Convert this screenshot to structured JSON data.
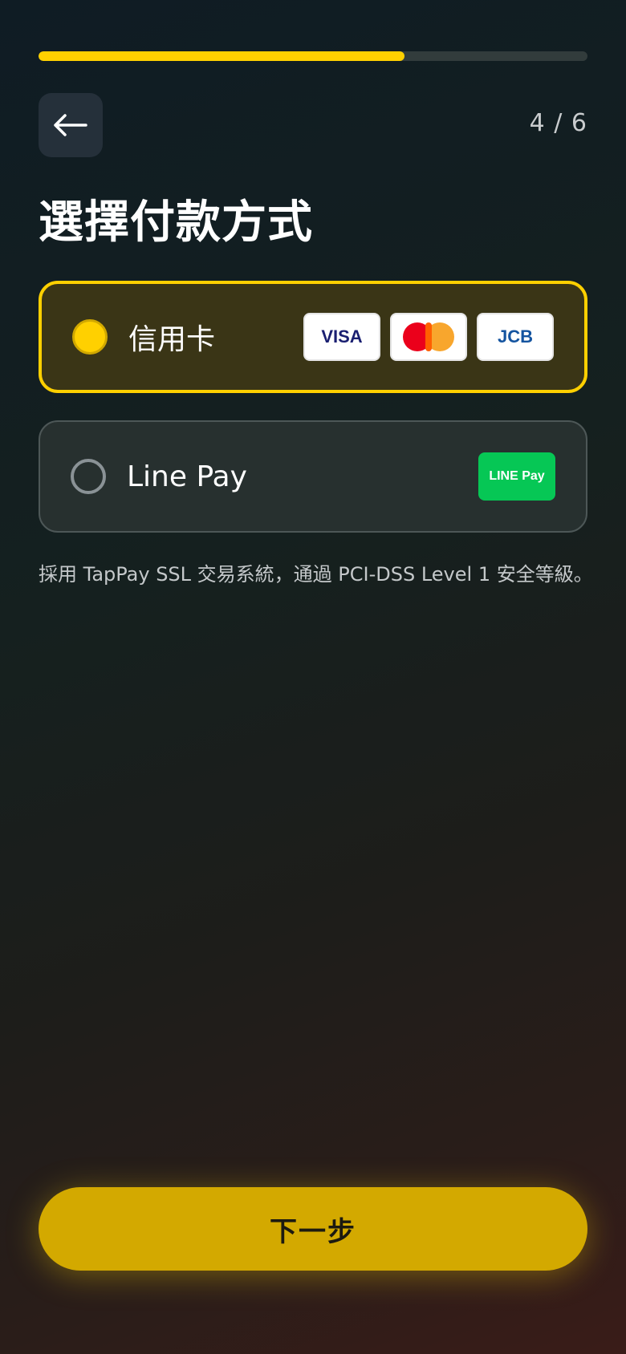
{
  "progress": {
    "current": 4,
    "total": 6,
    "fill_fraction": 0.667,
    "counter_text": "4 / 6"
  },
  "header": {
    "back_icon": "arrow-left-icon",
    "title": "選擇付款方式"
  },
  "options": [
    {
      "label": "信用卡",
      "selected": true,
      "badges": [
        "VISA",
        "mastercard-logo",
        "JCB"
      ]
    },
    {
      "label": "Line Pay",
      "selected": false,
      "badges": [
        "LINE Pay"
      ]
    }
  ],
  "security_note": "採用 TapPay SSL 交易系統，通過 PCI-DSS Level 1 安全等級。",
  "next_button_label": "下一步",
  "colors": {
    "accent": "#ffd000",
    "line_green": "#06c755"
  }
}
